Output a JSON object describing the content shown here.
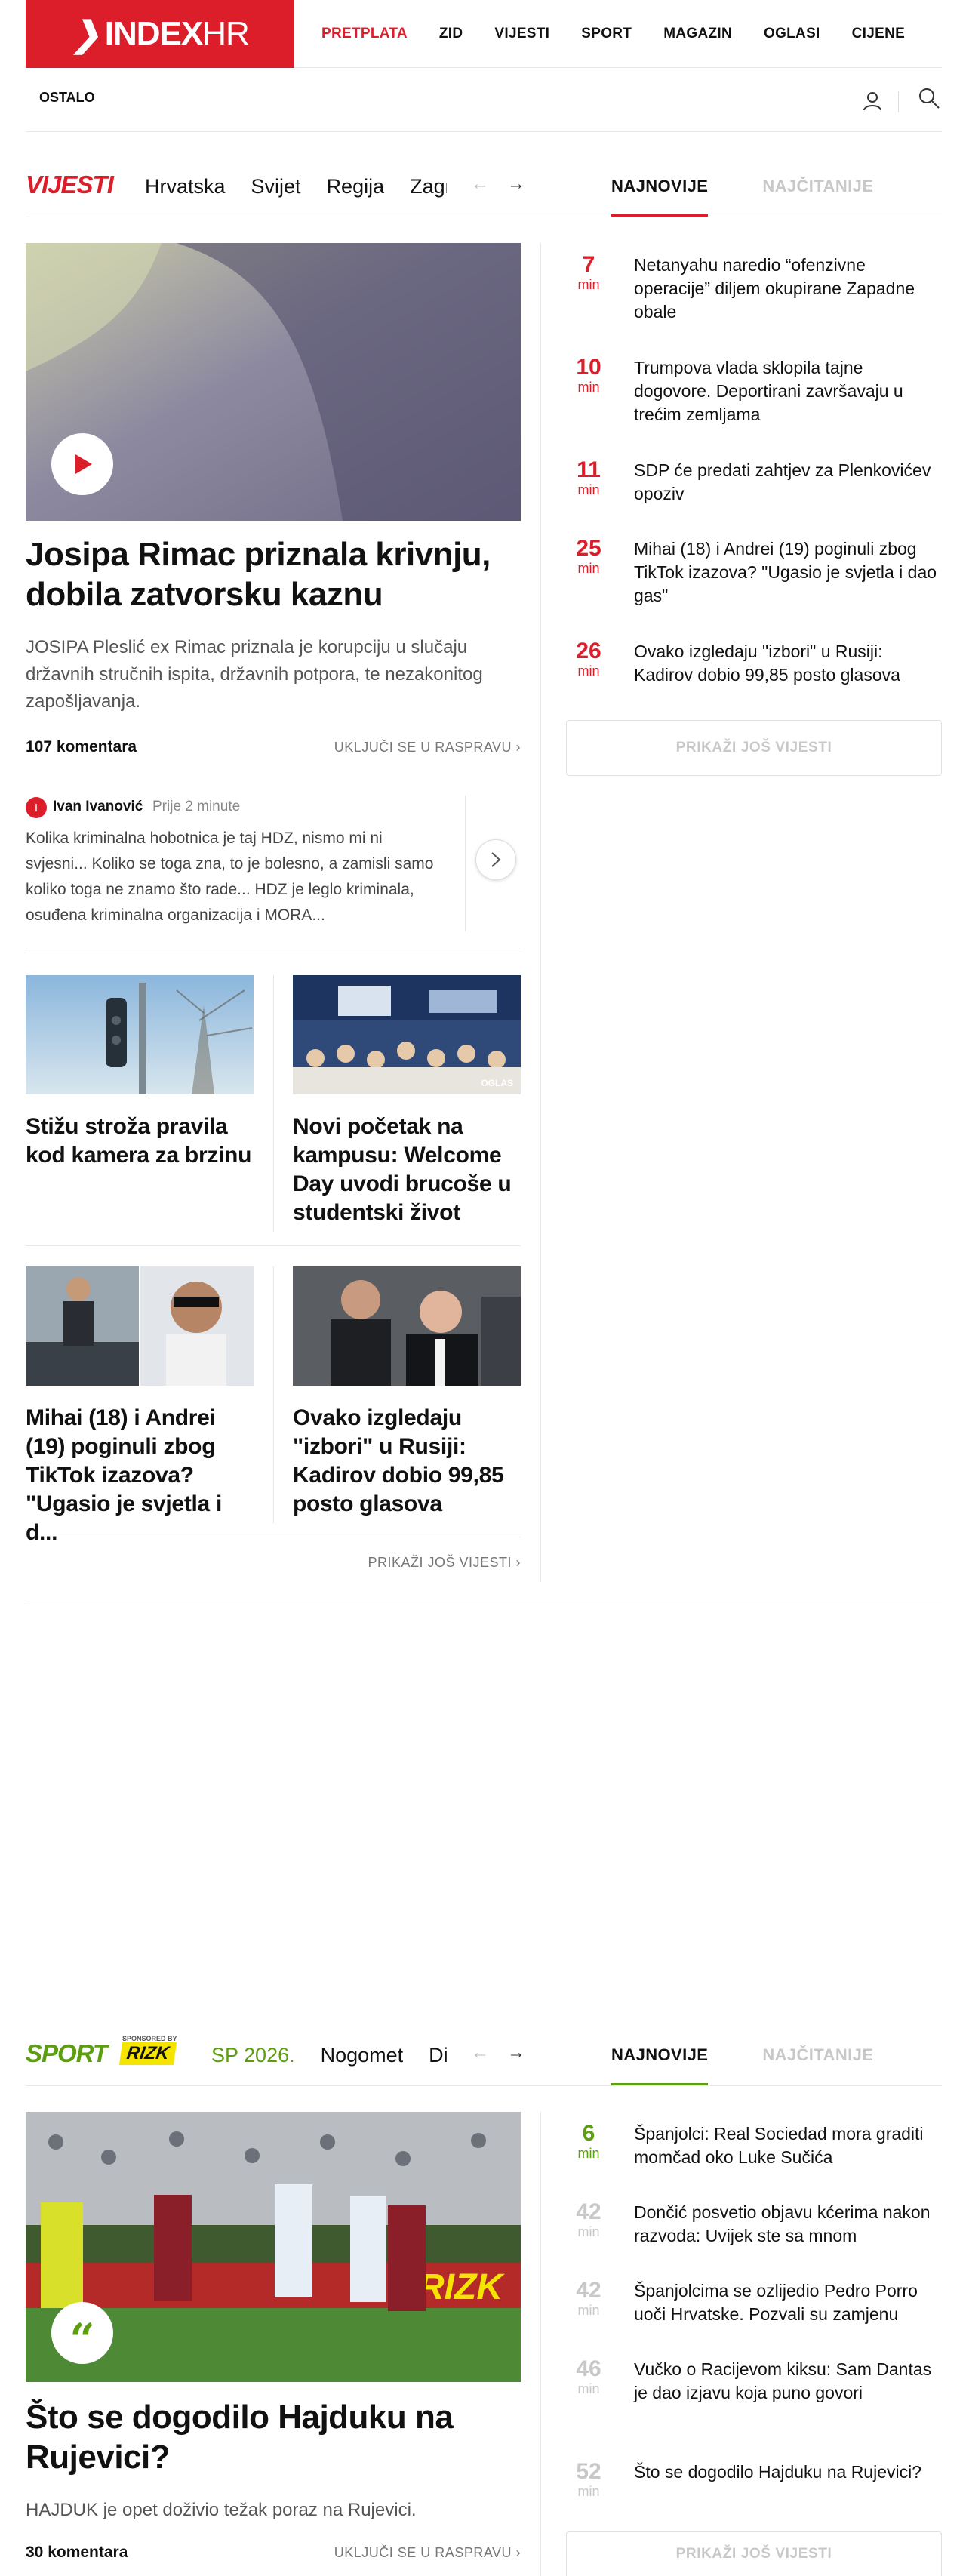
{
  "logo": {
    "mark": "❯",
    "text_bold": "INDEX",
    "text_light": "HR"
  },
  "nav": [
    "PRETPLATA",
    "ZID",
    "VIJESTI",
    "SPORT",
    "MAGAZIN",
    "OGLASI",
    "CIJENE"
  ],
  "subnav": {
    "ostalo": "OSTALO",
    "user_icon": "user-icon",
    "search_icon": "search-icon"
  },
  "colors": {
    "brand": "#dc1e2b",
    "sport": "#5c9e10"
  },
  "vijesti": {
    "title": "VIJESTI",
    "categories": [
      "Hrvatska",
      "Svijet",
      "Regija",
      "Zagr"
    ],
    "tabs": {
      "newest": "NAJNOVIJE",
      "most_read": "NAJČITANIJE"
    },
    "lead": {
      "title": "Josipa Rimac priznala krivnju, dobila zatvorsku kaznu",
      "subtitle": "JOSIPA Pleslić ex Rimac priznala je korupciju u slučaju državnih stručnih ispita, državnih potpora, te nezakonitog zapošljavanja.",
      "comments": "107 komentara",
      "join": "UKLJUČI SE U RASPRAVU ›"
    },
    "comment": {
      "avatar": "I",
      "author": "Ivan Ivanović",
      "time": "Prije 2 minute",
      "text": "Kolika kriminalna hobotnica je taj HDZ, nismo mi ni svjesni... Koliko se toga zna, to je bolesno, a zamisli samo koliko toga ne znamo što rade... HDZ je leglo kriminala, osuđena kriminalna organizacija i MORA..."
    },
    "cards": [
      {
        "title": "Stižu stroža pravila kod kamera za brzinu"
      },
      {
        "title": "Novi početak na kampusu: Welcome Day uvodi brucoše u studentski život",
        "badge": "OGLAS"
      },
      {
        "title": "Mihai (18) i Andrei (19) poginuli zbog TikTok izazova? \"Ugasio je svjetla i d..."
      },
      {
        "title": "Ovako izgledaju \"izbori\" u Rusiji: Kadirov dobio 99,85 posto glasova"
      }
    ],
    "more_link": "PRIKAŽI JOŠ VIJESTI ›",
    "latest": [
      {
        "num": "7",
        "unit": "min",
        "text": "Netanyahu naredio “ofenzivne operacije” diljem okupirane Zapadne obale"
      },
      {
        "num": "10",
        "unit": "min",
        "text": "Trumpova vlada sklopila tajne dogovore. Deportirani završavaju u trećim zemljama"
      },
      {
        "num": "11",
        "unit": "min",
        "text": "SDP će predati zahtjev za Plenkovićev opoziv"
      },
      {
        "num": "25",
        "unit": "min",
        "text": "Mihai (18) i Andrei (19) poginuli zbog TikTok izazova? \"Ugasio je svjetla i dao gas\""
      },
      {
        "num": "26",
        "unit": "min",
        "text": "Ovako izgledaju \"izbori\" u Rusiji: Kadirov dobio 99,85 posto glasova"
      }
    ],
    "more_button": "PRIKAŽI JOŠ VIJESTI"
  },
  "sport": {
    "title": "SPORT",
    "sponsor_small": "SPONSORED BY",
    "sponsor": "RIZK",
    "categories": [
      "SP 2026.",
      "Nogomet",
      "Di"
    ],
    "tabs": {
      "newest": "NAJNOVIJE",
      "most_read": "NAJČITANIJE"
    },
    "lead": {
      "title": "Što se dogodilo Hajduku na Rujevici?",
      "subtitle": "HAJDUK je opet doživio težak poraz na Rujevici.",
      "comments": "30 komentara",
      "join": "UKLJUČI SE U RASPRAVU ›"
    },
    "latest": [
      {
        "num": "6",
        "unit": "min",
        "text": "Španjolci: Real Sociedad mora graditi momčad oko Luke Sučića"
      },
      {
        "num": "42",
        "unit": "min",
        "text": "Dončić posvetio objavu kćerima nakon razvoda: Uvijek ste sa mnom"
      },
      {
        "num": "42",
        "unit": "min",
        "text": "Španjolcima se ozlijedio Pedro Porro uoči Hrvatske. Pozvali su zamjenu"
      },
      {
        "num": "46",
        "unit": "min",
        "text": "Vučko o Racijevom kiksu: Sam Dantas je dao izjavu koja puno govori"
      },
      {
        "num": "52",
        "unit": "min",
        "text": "Što se dogodilo Hajduku na Rujevici?"
      }
    ],
    "more_button": "PRIKAŽI JOŠ VIJESTI"
  }
}
